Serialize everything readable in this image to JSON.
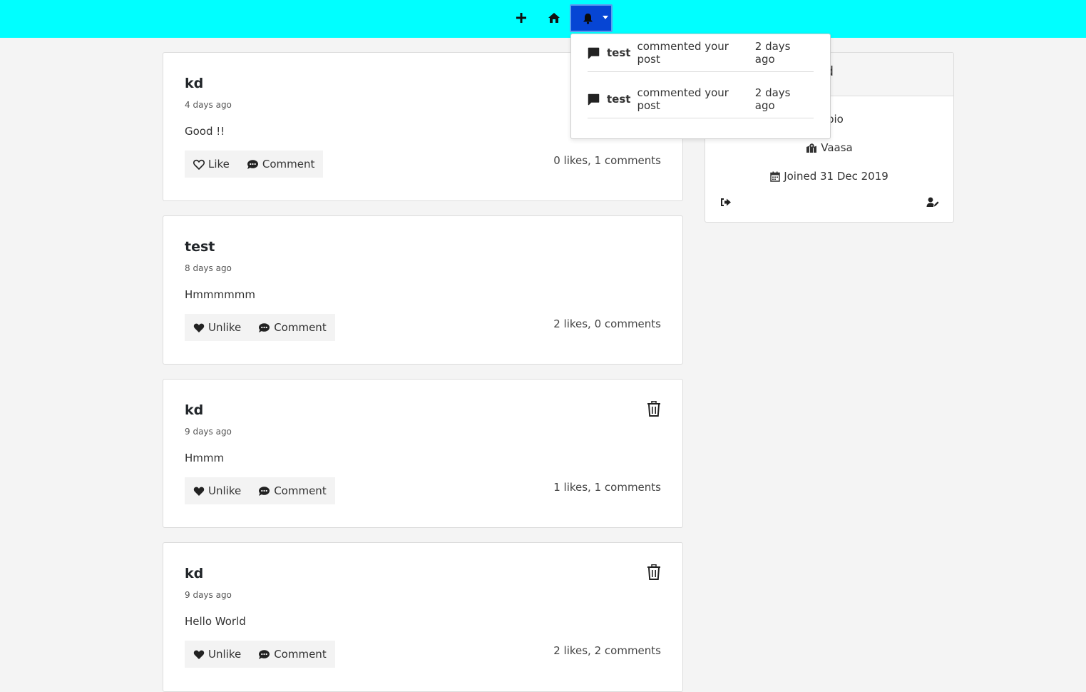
{
  "navbar": {
    "add_icon": "plus-icon",
    "home_icon": "home-icon",
    "notifications_icon": "bell-icon",
    "accent": "#00ffff",
    "active_button_color": "#0645d4"
  },
  "posts": [
    {
      "user": "kd",
      "time": "4 days ago",
      "body": "Good !!",
      "like_label": "Like",
      "liked": false,
      "comment_label": "Comment",
      "counts": "0 likes, 1 comments",
      "deletable": false
    },
    {
      "user": "test",
      "time": "8 days ago",
      "body": "Hmmmmmm",
      "like_label": "Unlike",
      "liked": true,
      "comment_label": "Comment",
      "counts": "2 likes, 0 comments",
      "deletable": false
    },
    {
      "user": "kd",
      "time": "9 days ago",
      "body": "Hmmm",
      "like_label": "Unlike",
      "liked": true,
      "comment_label": "Comment",
      "counts": "1 likes, 1 comments",
      "deletable": true
    },
    {
      "user": "kd",
      "time": "9 days ago",
      "body": "Hello World",
      "like_label": "Unlike",
      "liked": true,
      "comment_label": "Comment",
      "counts": "2 likes, 2 comments",
      "deletable": true
    }
  ],
  "profile": {
    "name_visible": "d",
    "bio_visible": "is bio",
    "location": "Vaasa",
    "joined": "Joined 31 Dec 2019"
  },
  "notifications": [
    {
      "user": "test",
      "text": "commented your post",
      "time": "2 days ago"
    },
    {
      "user": "test",
      "text": "commented your post",
      "time": "2 days ago"
    }
  ]
}
